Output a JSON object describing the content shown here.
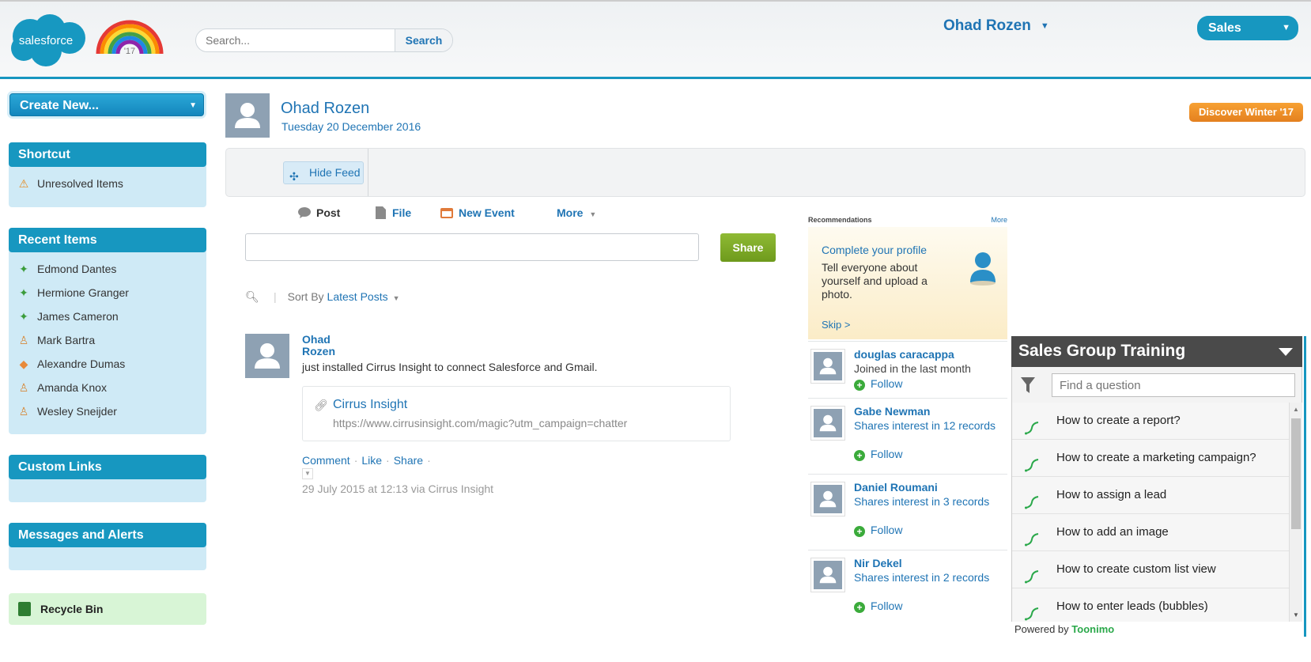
{
  "header": {
    "logo_text": "salesforce",
    "release_badge": "'17",
    "search_placeholder": "Search...",
    "search_button": "Search",
    "user_name": "Ohad Rozen",
    "app_name": "Sales"
  },
  "sidebar": {
    "create_new": "Create New...",
    "shortcut": {
      "title": "Shortcut",
      "items": [
        {
          "label": "Unresolved Items",
          "icon": "warning-icon"
        }
      ]
    },
    "recent": {
      "title": "Recent Items",
      "items": [
        {
          "label": "Edmond Dantes",
          "icon": "contact-icon"
        },
        {
          "label": "Hermione Granger",
          "icon": "contact-icon"
        },
        {
          "label": "James Cameron",
          "icon": "contact-icon"
        },
        {
          "label": "Mark Bartra",
          "icon": "lead-icon"
        },
        {
          "label": "Alexandre Dumas",
          "icon": "account-icon"
        },
        {
          "label": "Amanda Knox",
          "icon": "lead-icon"
        },
        {
          "label": "Wesley Sneijder",
          "icon": "lead-icon"
        }
      ]
    },
    "custom_links": {
      "title": "Custom Links"
    },
    "messages": {
      "title": "Messages and Alerts"
    },
    "recycle_bin": "Recycle Bin"
  },
  "profile": {
    "name": "Ohad Rozen",
    "date": "Tuesday 20 December 2016",
    "discover_button": "Discover Winter '17",
    "hide_feed": "Hide Feed"
  },
  "publisher": {
    "tabs": [
      {
        "label": "Post",
        "icon": "post-icon"
      },
      {
        "label": "File",
        "icon": "file-icon"
      },
      {
        "label": "New Event",
        "icon": "calendar-icon"
      },
      {
        "label": "More",
        "icon": "chevron-down-icon"
      }
    ],
    "share_button": "Share",
    "sort_label": "Sort By",
    "sort_value": "Latest Posts"
  },
  "post": {
    "author_first": "Ohad",
    "author_last": "Rozen",
    "body": "just installed Cirrus Insight to connect Salesforce and Gmail.",
    "link_title": "Cirrus Insight",
    "link_url": "https://www.cirrusinsight.com/magic?utm_campaign=chatter",
    "actions": [
      "Comment",
      "Like",
      "Share"
    ],
    "meta": "29 July 2015 at 12:13  via Cirrus Insight"
  },
  "recommendations": {
    "title": "Recommendations",
    "more": "More",
    "profile_card": {
      "title": "Complete your profile",
      "text": "Tell everyone about yourself and upload a photo.",
      "skip": "Skip >"
    },
    "people": [
      {
        "name": "douglas caracappa",
        "desc": "Joined in the last month",
        "follow": "Follow"
      },
      {
        "name": "Gabe Newman",
        "desc": "Shares interest in 12 records",
        "follow": "Follow"
      },
      {
        "name": "Daniel Roumani",
        "desc": "Shares interest in 3 records",
        "follow": "Follow"
      },
      {
        "name": "Nir Dekel",
        "desc": "Shares interest in 2 records",
        "follow": "Follow"
      }
    ]
  },
  "training": {
    "title": "Sales Group Training",
    "search_placeholder": "Find a question",
    "items": [
      "How to create a report?",
      "How to create a marketing campaign?",
      "How to assign a lead",
      "How to add an image",
      "How to create custom list view",
      "How to enter leads (bubbles)"
    ],
    "powered_by": "Powered by",
    "brand": "Toonimo"
  },
  "colors": {
    "accent": "#1797c0",
    "link": "#1f74b4",
    "share_green": "#7aa626",
    "discover_orange": "#ee9028",
    "toonimo_green": "#2aa84a"
  }
}
